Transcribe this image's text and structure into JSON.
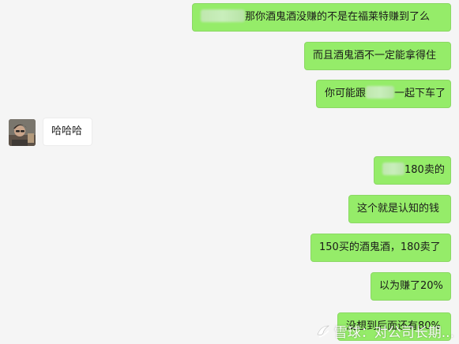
{
  "messages": [
    {
      "side": "right",
      "text": "那你酒鬼酒没赚的不是在福莱特赚到了么"
    },
    {
      "side": "right",
      "text": "而且酒鬼酒不一定能拿得住"
    },
    {
      "side": "right",
      "text_before": "你可能跟",
      "text_after": "一起下车了"
    },
    {
      "side": "left",
      "text": "哈哈哈"
    },
    {
      "side": "right",
      "text": "180卖的"
    },
    {
      "side": "right",
      "text": "这个就是认知的钱"
    },
    {
      "side": "right",
      "text": "150买的酒鬼酒，180卖了"
    },
    {
      "side": "right",
      "text": "以为赚了20%"
    },
    {
      "side": "right",
      "text": "没想到后面还有80%"
    }
  ],
  "watermark": {
    "text": "雪球：对公司长期...",
    "logo_icon": "snowball-logo-icon"
  },
  "colors": {
    "self_bubble": "#95ec69",
    "other_bubble": "#ffffff",
    "background": "#f5f5f5"
  }
}
